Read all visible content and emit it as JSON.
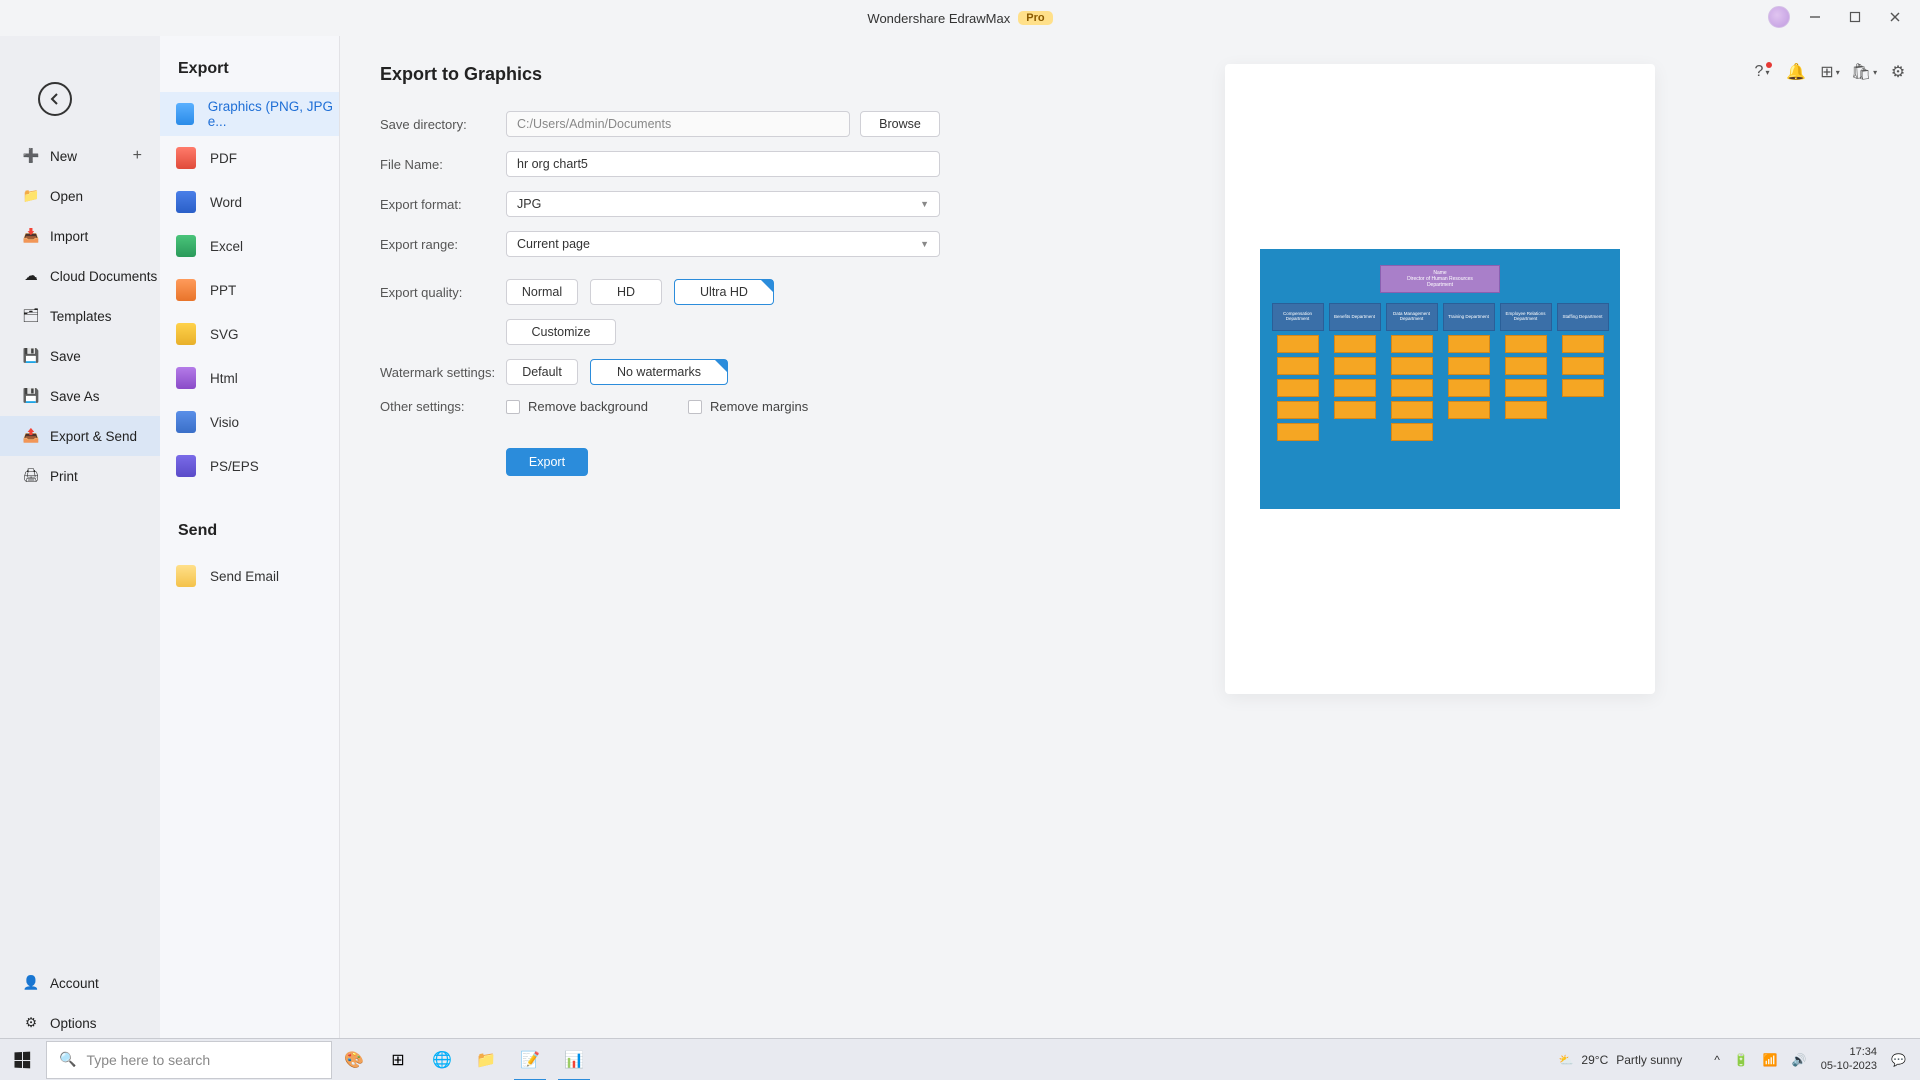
{
  "titlebar": {
    "app_name": "Wondershare EdrawMax",
    "badge": "Pro"
  },
  "nav": {
    "items": [
      {
        "label": "New"
      },
      {
        "label": "Open"
      },
      {
        "label": "Import"
      },
      {
        "label": "Cloud Documents"
      },
      {
        "label": "Templates"
      },
      {
        "label": "Save"
      },
      {
        "label": "Save As"
      },
      {
        "label": "Export & Send"
      },
      {
        "label": "Print"
      }
    ],
    "bottom": [
      {
        "label": "Account"
      },
      {
        "label": "Options"
      }
    ]
  },
  "export_section": {
    "heading": "Export",
    "items": [
      {
        "label": "Graphics (PNG, JPG e..."
      },
      {
        "label": "PDF"
      },
      {
        "label": "Word"
      },
      {
        "label": "Excel"
      },
      {
        "label": "PPT"
      },
      {
        "label": "SVG"
      },
      {
        "label": "Html"
      },
      {
        "label": "Visio"
      },
      {
        "label": "PS/EPS"
      }
    ],
    "send_heading": "Send",
    "send_items": [
      {
        "label": "Send Email"
      }
    ]
  },
  "form": {
    "heading": "Export to Graphics",
    "save_dir_label": "Save directory:",
    "save_dir_value": "C:/Users/Admin/Documents",
    "browse": "Browse",
    "filename_label": "File Name:",
    "filename_value": "hr org chart5",
    "format_label": "Export format:",
    "format_value": "JPG",
    "range_label": "Export range:",
    "range_value": "Current page",
    "quality_label": "Export quality:",
    "quality_normal": "Normal",
    "quality_hd": "HD",
    "quality_ultra": "Ultra HD",
    "quality_customize": "Customize",
    "watermark_label": "Watermark settings:",
    "watermark_default": "Default",
    "watermark_none": "No watermarks",
    "other_label": "Other settings:",
    "remove_bg": "Remove background",
    "remove_margins": "Remove margins",
    "export_btn": "Export"
  },
  "preview_chart": {
    "root_title": "Name",
    "root_subtitle": "Director of Human Resources",
    "root_dept": "Department",
    "depts": [
      "Compensation Department",
      "Benefits Department",
      "Data Management Department",
      "Training Department",
      "Employee Relations Department",
      "Staffing Department"
    ]
  },
  "taskbar": {
    "search_placeholder": "Type here to search",
    "weather_temp": "29°C",
    "weather_desc": "Partly sunny",
    "time": "17:34",
    "date": "05-10-2023"
  }
}
